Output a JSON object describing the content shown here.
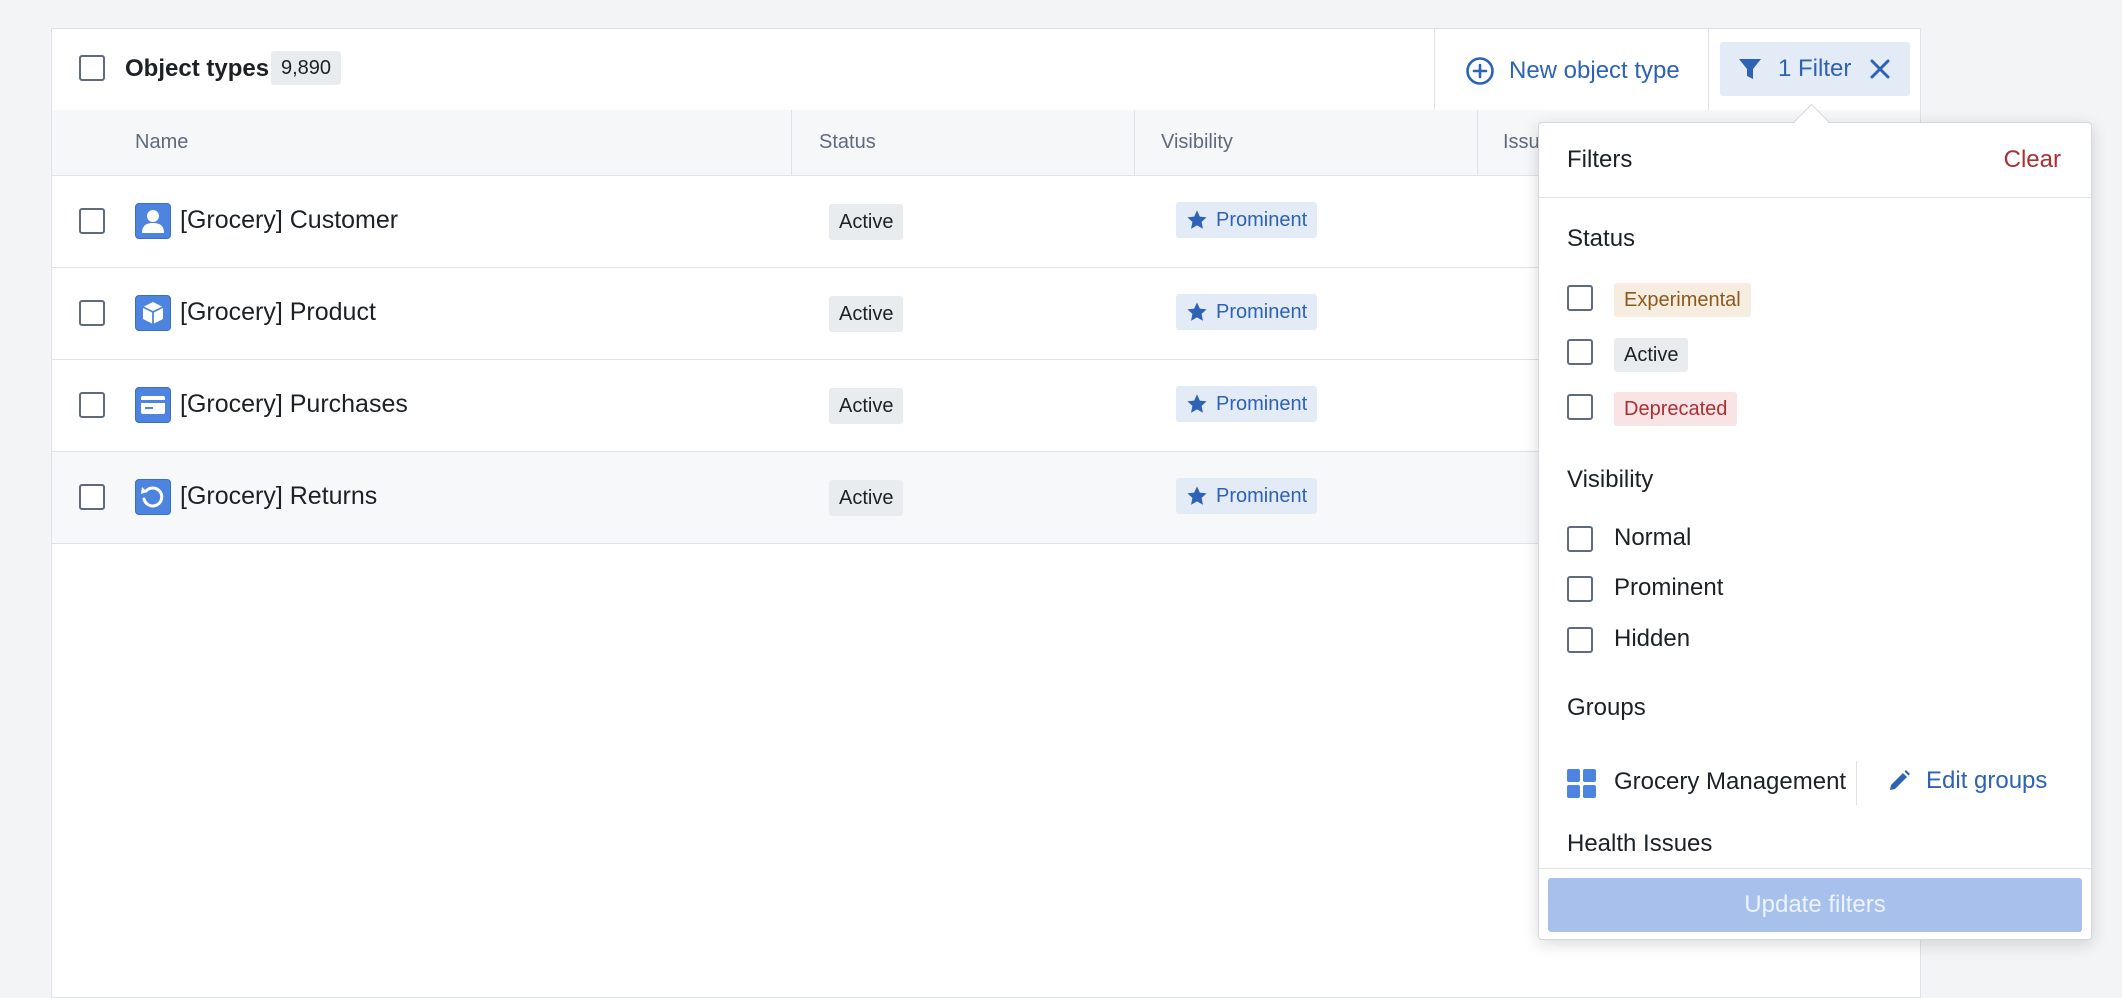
{
  "header": {
    "title": "Object types",
    "count": "9,890",
    "new_button_label": "New object type",
    "filter_button_label": "1 Filter"
  },
  "table": {
    "columns": [
      "Name",
      "Status",
      "Visibility",
      "Issu"
    ],
    "rows": [
      {
        "name": "[Grocery] Customer",
        "status": "Active",
        "visibility": "Prominent",
        "icon": "person-icon"
      },
      {
        "name": "[Grocery] Product",
        "status": "Active",
        "visibility": "Prominent",
        "icon": "cube-icon"
      },
      {
        "name": "[Grocery] Purchases",
        "status": "Active",
        "visibility": "Prominent",
        "icon": "credit-card-icon"
      },
      {
        "name": "[Grocery] Returns",
        "status": "Active",
        "visibility": "Prominent",
        "icon": "refresh-icon"
      }
    ]
  },
  "filters": {
    "title": "Filters",
    "clear_label": "Clear",
    "status_heading": "Status",
    "status_options": [
      {
        "label": "Experimental",
        "color": "#8a5a1e",
        "bg": "#f6ecdf"
      },
      {
        "label": "Active",
        "color": "#1c2127",
        "bg": "#e9ecef"
      },
      {
        "label": "Deprecated",
        "color": "#ac2f33",
        "bg": "#f8e4e4"
      }
    ],
    "visibility_heading": "Visibility",
    "visibility_options": [
      "Normal",
      "Prominent",
      "Hidden"
    ],
    "groups_heading": "Groups",
    "group_name": "Grocery Management",
    "edit_groups_label": "Edit groups",
    "health_heading": "Health Issues",
    "update_label": "Update filters"
  },
  "colors": {
    "accent": "#2d62b5",
    "danger": "#ac2f33",
    "icon_blue": "#4c84e0"
  }
}
